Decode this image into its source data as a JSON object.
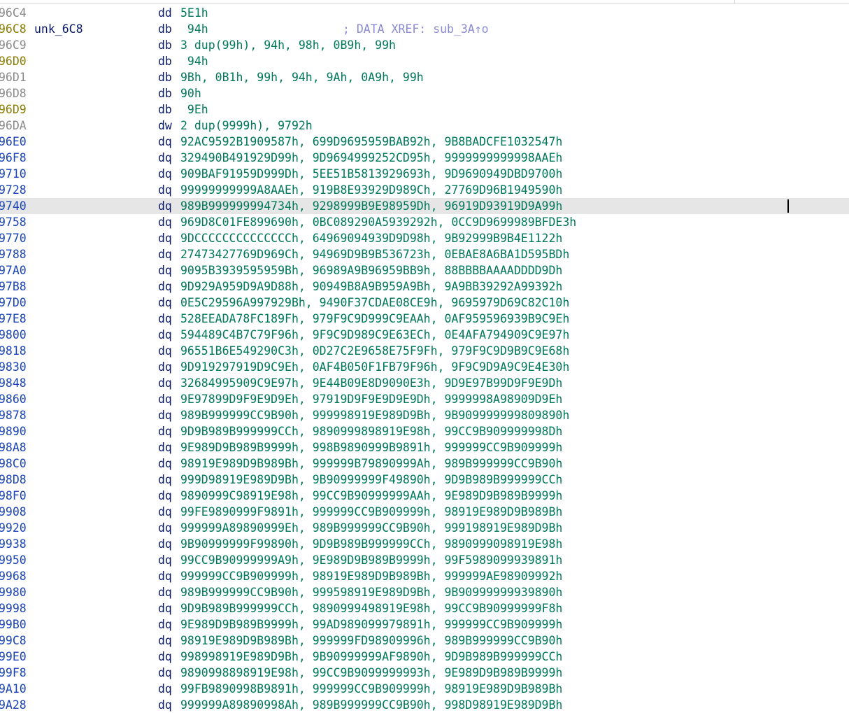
{
  "listing": {
    "lines": [
      {
        "addr": "96C4",
        "addr_color": "gray",
        "label": "",
        "dir": "dd",
        "ops": "5E1h",
        "comment": ""
      },
      {
        "addr": "96C8",
        "addr_color": "olive",
        "label": "unk_6C8",
        "dir": "db",
        "ops": " 94h",
        "comment": "; DATA XREF: sub_3A↑o"
      },
      {
        "addr": "96C9",
        "addr_color": "gray",
        "label": "",
        "dir": "db",
        "ops": "3 dup(99h), 94h, 98h, 0B9h, 99h",
        "comment": ""
      },
      {
        "addr": "96D0",
        "addr_color": "olive",
        "label": "",
        "dir": "db",
        "ops": " 94h",
        "comment": ""
      },
      {
        "addr": "96D1",
        "addr_color": "gray",
        "label": "",
        "dir": "db",
        "ops": "9Bh, 0B1h, 99h, 94h, 9Ah, 0A9h, 99h",
        "comment": ""
      },
      {
        "addr": "96D8",
        "addr_color": "gray",
        "label": "",
        "dir": "db",
        "ops": "90h",
        "comment": ""
      },
      {
        "addr": "96D9",
        "addr_color": "olive",
        "label": "",
        "dir": "db",
        "ops": " 9Eh",
        "comment": ""
      },
      {
        "addr": "96DA",
        "addr_color": "gray",
        "label": "",
        "dir": "dw",
        "ops": "2 dup(9999h), 9792h",
        "comment": ""
      },
      {
        "addr": "96E0",
        "addr_color": "blue",
        "label": "",
        "dir": "dq",
        "ops": "92AC9592B1909587h, 699D9695959BAB92h, 9B8BADCFE1032547h",
        "comment": ""
      },
      {
        "addr": "96F8",
        "addr_color": "blue",
        "label": "",
        "dir": "dq",
        "ops": "329490B491929D99h, 9D9694999252CD95h, 9999999999998AAEh",
        "comment": ""
      },
      {
        "addr": "9710",
        "addr_color": "blue",
        "label": "",
        "dir": "dq",
        "ops": "909BAF91959D999Dh, 5EE51B5813929693h, 9D9690949DBD9700h",
        "comment": ""
      },
      {
        "addr": "9728",
        "addr_color": "blue",
        "label": "",
        "dir": "dq",
        "ops": "99999999999A8AAEh, 919B8E93929D989Ch, 27769D96B1949590h",
        "comment": ""
      },
      {
        "addr": "9740",
        "addr_color": "blue",
        "label": "",
        "dir": "dq",
        "ops": "989B999999994734h, 9298999B9E98959Dh, 96919D93919D9A99h",
        "comment": "",
        "current": true
      },
      {
        "addr": "9758",
        "addr_color": "blue",
        "label": "",
        "dir": "dq",
        "ops": "969D8C01FE899690h, 0BC089290A5939292h, 0CC9D9699989BFDE3h",
        "comment": ""
      },
      {
        "addr": "9770",
        "addr_color": "blue",
        "label": "",
        "dir": "dq",
        "ops": "9DCCCCCCCCCCCCCCh, 64969094939D9D98h, 9B92999B9B4E1122h",
        "comment": ""
      },
      {
        "addr": "9788",
        "addr_color": "blue",
        "label": "",
        "dir": "dq",
        "ops": "27473427769D969Ch, 94969D9B9B536723h, 0EBAE8A6BA1D595BDh",
        "comment": ""
      },
      {
        "addr": "97A0",
        "addr_color": "blue",
        "label": "",
        "dir": "dq",
        "ops": "9095B3939595959Bh, 96989A9B96959BB9h, 88BBBBAAAADDDD9Dh",
        "comment": ""
      },
      {
        "addr": "97B8",
        "addr_color": "blue",
        "label": "",
        "dir": "dq",
        "ops": "9D929A959D9A9D88h, 90949B8A9B959A9Bh, 9A9BB39292A99392h",
        "comment": ""
      },
      {
        "addr": "97D0",
        "addr_color": "blue",
        "label": "",
        "dir": "dq",
        "ops": "0E5C29596A997929Bh, 9490F37CDAE08CE9h, 9695979D69C82C10h",
        "comment": ""
      },
      {
        "addr": "97E8",
        "addr_color": "blue",
        "label": "",
        "dir": "dq",
        "ops": "528EEADA78FC189Fh, 979F9C9D999C9EAAh, 0AF959596939B9C9Eh",
        "comment": ""
      },
      {
        "addr": "9800",
        "addr_color": "blue",
        "label": "",
        "dir": "dq",
        "ops": "594489C4B7C79F96h, 9F9C9D989C9E63ECh, 0E4AFA794909C9E97h",
        "comment": ""
      },
      {
        "addr": "9818",
        "addr_color": "blue",
        "label": "",
        "dir": "dq",
        "ops": "96551B6E549290C3h, 0D27C2E9658E75F9Fh, 979F9C9D9B9C9E68h",
        "comment": ""
      },
      {
        "addr": "9830",
        "addr_color": "blue",
        "label": "",
        "dir": "dq",
        "ops": "9D919297919D9C9Eh, 0AF4B050F1FB79F96h, 9F9C9D9A9C9E4E30h",
        "comment": ""
      },
      {
        "addr": "9848",
        "addr_color": "blue",
        "label": "",
        "dir": "dq",
        "ops": "32684995909C9E97h, 9E44B09E8D9090E3h, 9D9E97B99D9F9E9Dh",
        "comment": ""
      },
      {
        "addr": "9860",
        "addr_color": "blue",
        "label": "",
        "dir": "dq",
        "ops": "9E97899D9F9E9D9Eh, 97919D9F9E9D9E9Dh, 9999998A98909D9Eh",
        "comment": ""
      },
      {
        "addr": "9878",
        "addr_color": "blue",
        "label": "",
        "dir": "dq",
        "ops": "989B999999CC9B90h, 999998919E989D9Bh, 9B909999999809890h",
        "comment": ""
      },
      {
        "addr": "9890",
        "addr_color": "blue",
        "label": "",
        "dir": "dq",
        "ops": "9D9B989B999999CCh, 9890999898919E98h, 99CC9B909999998Dh",
        "comment": ""
      },
      {
        "addr": "98A8",
        "addr_color": "blue",
        "label": "",
        "dir": "dq",
        "ops": "9E989D9B989B9999h, 998B9890999B9891h, 999999CC9B909999h",
        "comment": ""
      },
      {
        "addr": "98C0",
        "addr_color": "blue",
        "label": "",
        "dir": "dq",
        "ops": "98919E989D9B989Bh, 999999B79890999Ah, 989B999999CC9B90h",
        "comment": ""
      },
      {
        "addr": "98D8",
        "addr_color": "blue",
        "label": "",
        "dir": "dq",
        "ops": "999D98919E989D9Bh, 9B90999999F49890h, 9D9B989B999999CCh",
        "comment": ""
      },
      {
        "addr": "98F0",
        "addr_color": "blue",
        "label": "",
        "dir": "dq",
        "ops": "9890999C98919E98h, 99CC9B90999999AAh, 9E989D9B989B9999h",
        "comment": ""
      },
      {
        "addr": "9908",
        "addr_color": "blue",
        "label": "",
        "dir": "dq",
        "ops": "99FE9890999F9891h, 999999CC9B909999h, 98919E989D9B989Bh",
        "comment": ""
      },
      {
        "addr": "9920",
        "addr_color": "blue",
        "label": "",
        "dir": "dq",
        "ops": "999999A89890999Eh, 989B999999CC9B90h, 999198919E989D9Bh",
        "comment": ""
      },
      {
        "addr": "9938",
        "addr_color": "blue",
        "label": "",
        "dir": "dq",
        "ops": "9B90999999F99890h, 9D9B989B999999CCh, 9890999098919E98h",
        "comment": ""
      },
      {
        "addr": "9950",
        "addr_color": "blue",
        "label": "",
        "dir": "dq",
        "ops": "99CC9B90999999A9h, 9E989D9B989B9999h, 99F5989099939891h",
        "comment": ""
      },
      {
        "addr": "9968",
        "addr_color": "blue",
        "label": "",
        "dir": "dq",
        "ops": "999999CC9B909999h, 98919E989D9B989Bh, 999999AE98909992h",
        "comment": ""
      },
      {
        "addr": "9980",
        "addr_color": "blue",
        "label": "",
        "dir": "dq",
        "ops": "989B999999CC9B90h, 999598919E989D9Bh, 9B90999999939890h",
        "comment": ""
      },
      {
        "addr": "9998",
        "addr_color": "blue",
        "label": "",
        "dir": "dq",
        "ops": "9D9B989B999999CCh, 9890999498919E98h, 99CC9B90999999F8h",
        "comment": ""
      },
      {
        "addr": "99B0",
        "addr_color": "blue",
        "label": "",
        "dir": "dq",
        "ops": "9E989D9B989B9999h, 99AD989099979891h, 999999CC9B909999h",
        "comment": ""
      },
      {
        "addr": "99C8",
        "addr_color": "blue",
        "label": "",
        "dir": "dq",
        "ops": "98919E989D9B989Bh, 999999FD98909996h, 989B999999CC9B90h",
        "comment": ""
      },
      {
        "addr": "99E0",
        "addr_color": "blue",
        "label": "",
        "dir": "dq",
        "ops": "998998919E989D9Bh, 9B90999999AF9890h, 9D9B989B999999CCh",
        "comment": ""
      },
      {
        "addr": "99F8",
        "addr_color": "blue",
        "label": "",
        "dir": "dq",
        "ops": "9890998898919E98h, 99CC9B9099999993h, 9E989D9B989B9999h",
        "comment": ""
      },
      {
        "addr": "9A10",
        "addr_color": "blue",
        "label": "",
        "dir": "dq",
        "ops": "99FB9890998B9891h, 999999CC9B909999h, 98919E989D9B989Bh",
        "comment": ""
      },
      {
        "addr": "9A28",
        "addr_color": "blue",
        "label": "",
        "dir": "dq",
        "ops": "999999A89890998Ah, 989B999999CC9B90h, 998D98919E989D9Bh",
        "comment": ""
      }
    ]
  }
}
